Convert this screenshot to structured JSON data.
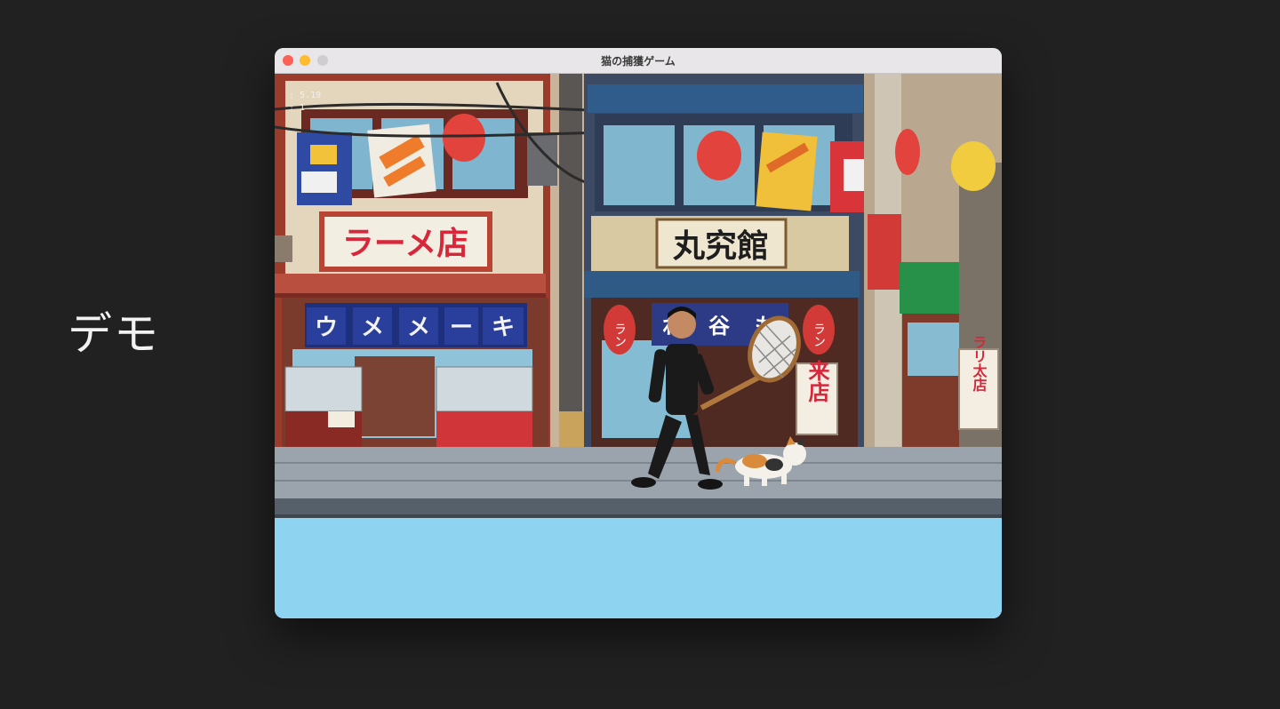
{
  "slide": {
    "label": "デモ"
  },
  "window": {
    "title": "猫の捕獲ゲーム"
  },
  "hud": {
    "line1": ": 5.19",
    "line2": ": 1"
  },
  "signs": {
    "ramen_shop": "ラーメ店",
    "noren_left": [
      "ウ",
      "メ",
      "メ",
      "ー",
      "キ"
    ],
    "center_board": "丸究館",
    "noren_center": [
      "れ",
      "谷",
      "も"
    ],
    "lantern_left": "ラン",
    "lantern_right": "ラン",
    "vertical_center": "来店",
    "vertical_right": "ラリ太店"
  },
  "colors": {
    "sky": "#8ed3ef",
    "backdrop": "#212121",
    "accent_red": "#d8263a"
  }
}
